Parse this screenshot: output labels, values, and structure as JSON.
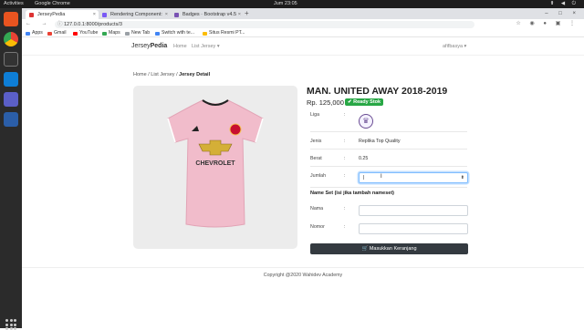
{
  "os": {
    "activities": "Activities",
    "app_name": "Google Chrome",
    "clock": "Jum 23:05"
  },
  "browser": {
    "tabs": [
      {
        "label": "JerseyPedia",
        "favicon_color": "#dd3333"
      },
      {
        "label": "Rendering Component:",
        "favicon_color": "#7a5af5"
      },
      {
        "label": "Badges · Bootstrap v4.5",
        "favicon_color": "#7952b3"
      }
    ],
    "url": "127.0.0.1:8000/products/3",
    "bookmarks": [
      {
        "label": "Apps",
        "color": "#4285f4"
      },
      {
        "label": "Gmail",
        "color": "#ea4335"
      },
      {
        "label": "YouTube",
        "color": "#ff0000"
      },
      {
        "label": "Maps",
        "color": "#34a853"
      },
      {
        "label": "New Tab",
        "color": "#9aa0a6"
      },
      {
        "label": "Switch with te...",
        "color": "#4285f4"
      },
      {
        "label": "Situs Resmi PT...",
        "color": "#fbbc05"
      }
    ]
  },
  "navbar": {
    "brand_prefix": "Jersey",
    "brand_bold": "Pedia",
    "home": "Home",
    "list_jersey": "List Jersey ▾",
    "user": "afifbasya ▾"
  },
  "breadcrumb": {
    "home": "Home",
    "sep1": "/",
    "list": "List Jersey",
    "sep2": "/",
    "current": "Jersey Detail"
  },
  "product": {
    "title": "MAN. UNITED AWAY 2018-2019",
    "price": "Rp. 125,000",
    "stock_badge": "✔ Ready Stok",
    "sponsor": "CHEVROLET",
    "shirt_color": "#f1bccb",
    "rows": [
      {
        "label": "Liga",
        "colon": ":",
        "value": ""
      },
      {
        "label": "Jenis",
        "colon": ":",
        "value": "Replika Top Quality"
      },
      {
        "label": "Berat",
        "colon": ":",
        "value": "0.25"
      },
      {
        "label": "Jumlah",
        "colon": ":",
        "value": ""
      }
    ],
    "quantity_value": "|",
    "nameset_title": "Name Set (isi jika tambah nameset)",
    "nama_label": "Nama",
    "nama_colon": ":",
    "nomor_label": "Nomor",
    "nomor_colon": ":",
    "cart_button": "🛒 Masukkan Keranjang"
  },
  "footer": {
    "copyright": "Copyright @2020 Wahidev Academy"
  }
}
